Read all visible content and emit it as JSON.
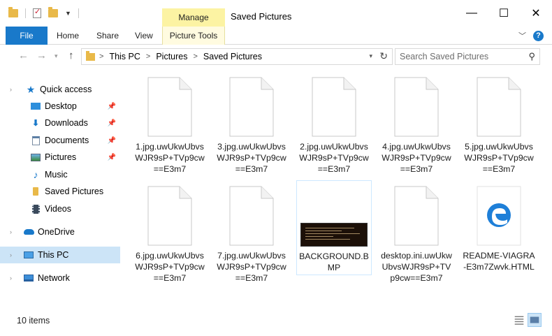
{
  "window": {
    "title": "Saved Pictures",
    "contextual_tab": "Manage",
    "buttons": {
      "minimize": "—",
      "maximize": "☐",
      "close": "✕"
    }
  },
  "ribbon": {
    "tabs": [
      "File",
      "Home",
      "Share",
      "View"
    ],
    "contextual_tool": "Picture Tools",
    "help": "?"
  },
  "address": {
    "crumbs": [
      "This PC",
      "Pictures",
      "Saved Pictures"
    ],
    "separator": ">"
  },
  "search": {
    "placeholder": "Search Saved Pictures"
  },
  "nav": {
    "quick_access": "Quick access",
    "items": [
      {
        "label": "Desktop",
        "icon": "desktop-icon",
        "pinned": true
      },
      {
        "label": "Downloads",
        "icon": "download-icon",
        "pinned": true
      },
      {
        "label": "Documents",
        "icon": "documents-icon",
        "pinned": true
      },
      {
        "label": "Pictures",
        "icon": "pictures-icon",
        "pinned": true
      },
      {
        "label": "Music",
        "icon": "music-icon",
        "pinned": false
      },
      {
        "label": "Saved Pictures",
        "icon": "folder-icon",
        "pinned": false
      },
      {
        "label": "Videos",
        "icon": "videos-icon",
        "pinned": false
      }
    ],
    "onedrive": "OneDrive",
    "this_pc": "This PC",
    "network": "Network"
  },
  "files": [
    {
      "name": "1.jpg.uwUkwUbvsWJR9sP+TVp9cw==E3m7",
      "kind": "blank"
    },
    {
      "name": "3.jpg.uwUkwUbvsWJR9sP+TVp9cw==E3m7",
      "kind": "blank"
    },
    {
      "name": "2.jpg.uwUkwUbvsWJR9sP+TVp9cw==E3m7",
      "kind": "blank"
    },
    {
      "name": "4.jpg.uwUkwUbvsWJR9sP+TVp9cw==E3m7",
      "kind": "blank"
    },
    {
      "name": "5.jpg.uwUkwUbvsWJR9sP+TVp9cw==E3m7",
      "kind": "blank"
    },
    {
      "name": "6.jpg.uwUkwUbvsWJR9sP+TVp9cw==E3m7",
      "kind": "blank"
    },
    {
      "name": "7.jpg.uwUkwUbvsWJR9sP+TVp9cw==E3m7",
      "kind": "blank"
    },
    {
      "name": "BACKGROUND.BMP",
      "kind": "bmp"
    },
    {
      "name": "desktop.ini.uwUkwUbvsWJR9sP+TVp9cw==E3m7",
      "kind": "blank"
    },
    {
      "name": "README-VIAGRA-E3m7Zwvk.HTML",
      "kind": "edge"
    }
  ],
  "status": {
    "item_count": "10 items"
  },
  "colors": {
    "accent": "#1979ca",
    "manage_tab": "#fcf3a3",
    "selection": "#cce4f7"
  }
}
